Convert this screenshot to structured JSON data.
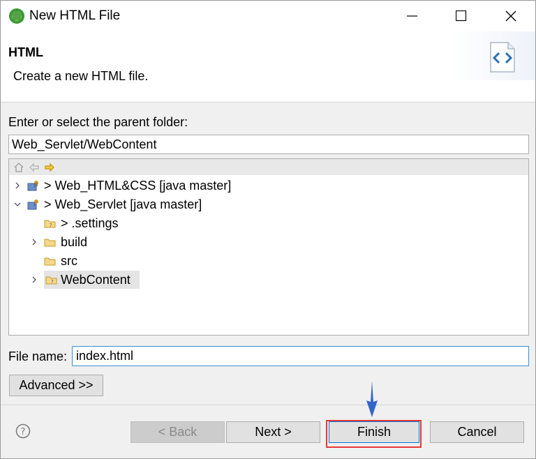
{
  "window": {
    "title": "New HTML File"
  },
  "banner": {
    "title": "HTML",
    "description": "Create a new HTML file."
  },
  "folder": {
    "label": "Enter or select the parent folder:",
    "value": "Web_Servlet/WebContent"
  },
  "tree": {
    "items": [
      {
        "label": "> Web_HTML&CSS [java master]",
        "expanded": false
      },
      {
        "label": "> Web_Servlet [java master]",
        "expanded": true
      },
      {
        "label": "> .settings"
      },
      {
        "label": "build",
        "expanded": false
      },
      {
        "label": "src"
      },
      {
        "label": "WebContent",
        "expanded": false,
        "selected": true
      }
    ]
  },
  "file_name": {
    "label": "File name:",
    "value": "index.html"
  },
  "buttons": {
    "advanced": "Advanced >>",
    "back": "< Back",
    "next": "Next >",
    "finish": "Finish",
    "cancel": "Cancel"
  },
  "icons": {
    "app": "eclipse-green-icon",
    "banner": "html-file-icon",
    "help": "question-circle-icon"
  },
  "colors": {
    "highlight": "#e53935",
    "arrow": "#3366cc",
    "focus": "#3b8fd5"
  }
}
